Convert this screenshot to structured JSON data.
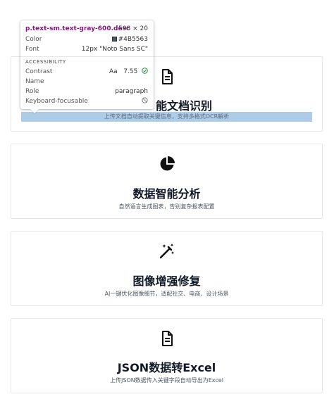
{
  "cards": [
    {
      "icon": "document-icon",
      "title": "能文档识别",
      "desc": "上传文档自动提取关键信息，支持多格式OCR解析"
    },
    {
      "icon": "pie-chart-icon",
      "title": "数据智能分析",
      "desc": "自然语言生成图表，告别复杂报表配置"
    },
    {
      "icon": "magic-wand-icon",
      "title": "图像增强修复",
      "desc": "AI一键优化图像细节，适配社交、电商、设计场景"
    },
    {
      "icon": "document-icon",
      "title": "JSON数据转Excel",
      "desc": "上传JSON数据传入关键字段自动导出为Excel"
    }
  ],
  "tooltip": {
    "selector": "p.text-sm.text-gray-600.desc",
    "size": "598 × 20",
    "color_label": "Color",
    "color_value": "#4B5563",
    "font_label": "Font",
    "font_value": "12px \"Noto Sans SC\"",
    "accessibility_heading": "ACCESSIBILITY",
    "contrast_label": "Contrast",
    "contrast_prefix": "Aa",
    "contrast_value": "7.55",
    "name_label": "Name",
    "role_label": "Role",
    "role_value": "paragraph",
    "keyboard_label": "Keyboard-focusable"
  },
  "colors": {
    "desc_text": "#4B5563",
    "highlight": "#9FC3E3",
    "contrast_ok": "#2e9e44"
  }
}
